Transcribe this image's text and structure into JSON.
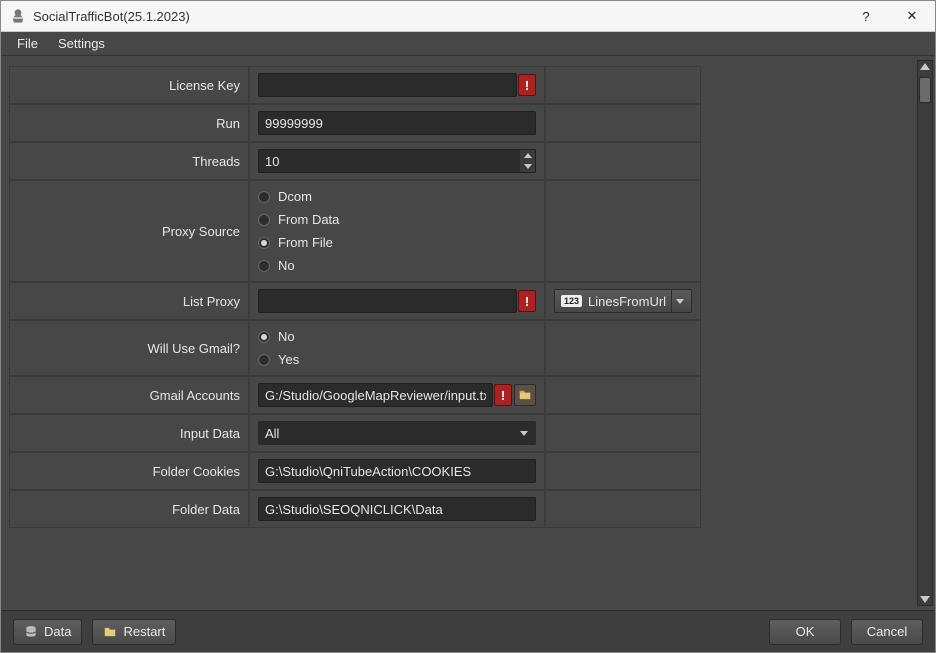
{
  "window": {
    "title": "SocialTrafficBot(25.1.2023)"
  },
  "menu": {
    "file": "File",
    "settings": "Settings"
  },
  "labels": {
    "license_key": "License Key",
    "run": "Run",
    "threads": "Threads",
    "proxy_source": "Proxy Source",
    "list_proxy": "List Proxy",
    "will_use_gmail": "Will Use Gmail?",
    "gmail_accounts": "Gmail Accounts",
    "input_data": "Input Data",
    "folder_cookies": "Folder Cookies",
    "folder_data": "Folder Data"
  },
  "fields": {
    "license_key": "",
    "run": "99999999",
    "threads": "10",
    "proxy_source_options": [
      "Dcom",
      "From Data",
      "From File",
      "No"
    ],
    "proxy_source_selected": "From File",
    "list_proxy": "",
    "list_proxy_mode": "LinesFromUrl",
    "gmail_options": [
      "No",
      "Yes"
    ],
    "gmail_selected": "No",
    "gmail_accounts": "G:/Studio/GoogleMapReviewer/input.txt",
    "input_data": "All",
    "folder_cookies": "G:\\Studio\\QniTubeAction\\COOKIES",
    "folder_data": "G:\\Studio\\SEOQNICLICK\\Data"
  },
  "warn_glyph": "!",
  "footer": {
    "data": "Data",
    "restart": "Restart",
    "ok": "OK",
    "cancel": "Cancel"
  },
  "titlebar_buttons": {
    "help": "?",
    "close": "✕"
  }
}
